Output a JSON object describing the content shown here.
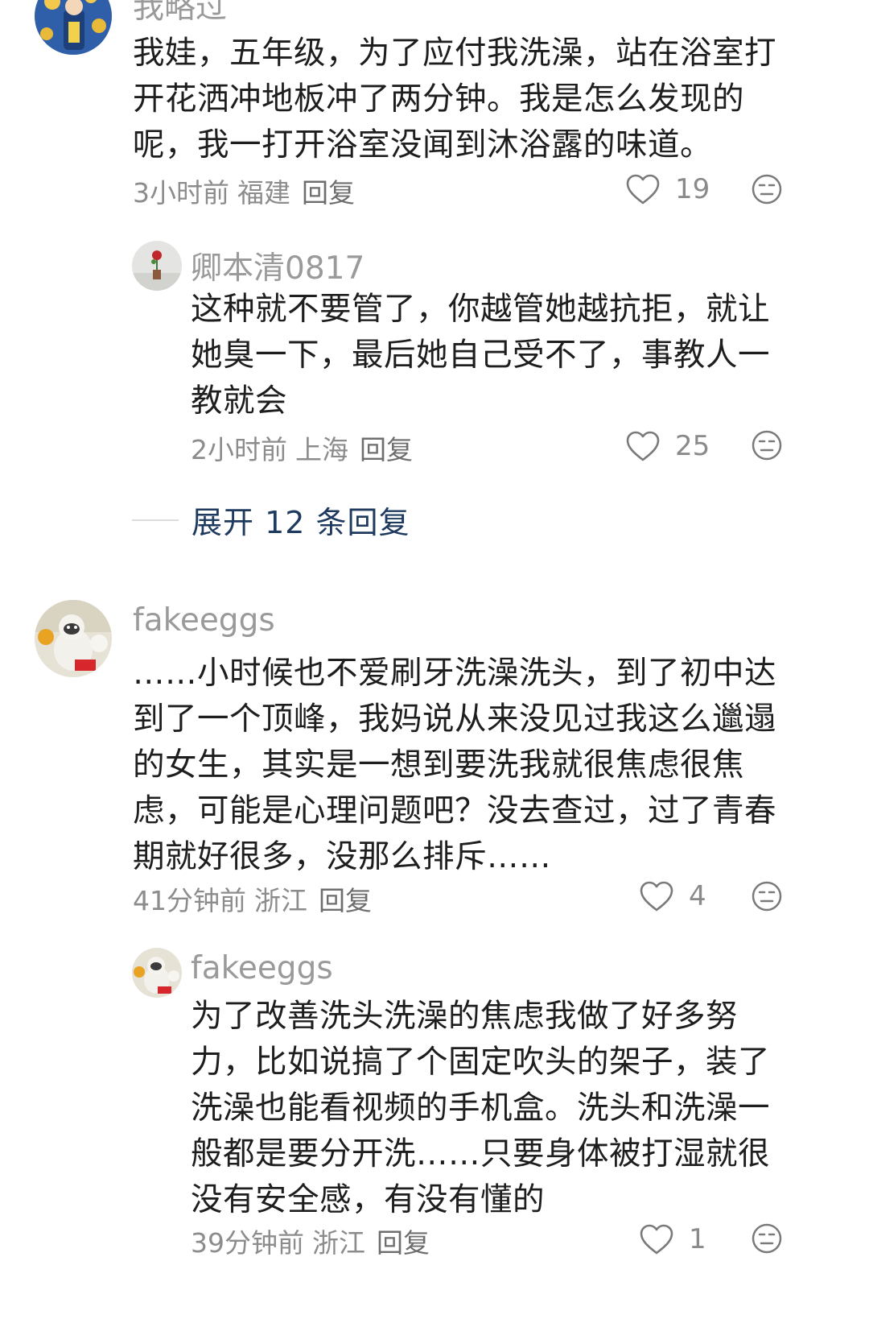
{
  "comments": [
    {
      "username": "我略过",
      "lines": [
        "我娃，五年级，为了应付我洗澡，站在浴室打",
        "开花洒冲地板冲了两分钟。我是怎么发现的",
        "呢，我一打开浴室没闻到沐浴露的味道。"
      ],
      "time": "3小时前",
      "location": "福建",
      "reply_label": "回复",
      "likes": "19"
    },
    {
      "username": "卿本清0817",
      "lines": [
        "这种就不要管了，你越管她越抗拒，就让",
        "她臭一下，最后她自己受不了，事教人一",
        "教就会"
      ],
      "time": "2小时前",
      "location": "上海",
      "reply_label": "回复",
      "likes": "25"
    },
    {
      "username": "fakeeggs",
      "lines": [
        "……小时候也不爱刷牙洗澡洗头，到了初中达",
        "到了一个顶峰，我妈说从来没见过我这么邋遢",
        "的女生，其实是一想到要洗我就很焦虑很焦",
        "虑，可能是心理问题吧？没去查过，过了青春",
        "期就好很多，没那么排斥……"
      ],
      "time": "41分钟前",
      "location": "浙江",
      "reply_label": "回复",
      "likes": "4"
    },
    {
      "username": "fakeeggs",
      "lines": [
        "为了改善洗头洗澡的焦虑我做了好多努",
        "力，比如说搞了个固定吹头的架子，装了",
        "洗澡也能看视频的手机盒。洗头和洗澡一",
        "般都是要分开洗……只要身体被打湿就很",
        "没有安全感，有没有懂的"
      ],
      "time": "39分钟前",
      "location": "浙江",
      "reply_label": "回复",
      "likes": "1"
    }
  ],
  "expand": {
    "label": "展开 12 条回复"
  },
  "icons": {
    "like": "heart-outline-icon",
    "dislike": "meh-face-icon"
  },
  "colors": {
    "username": "#9a9a9a",
    "text": "#1e1e1e",
    "meta": "#8c8c8c",
    "expand_link": "#1f3a5f"
  }
}
